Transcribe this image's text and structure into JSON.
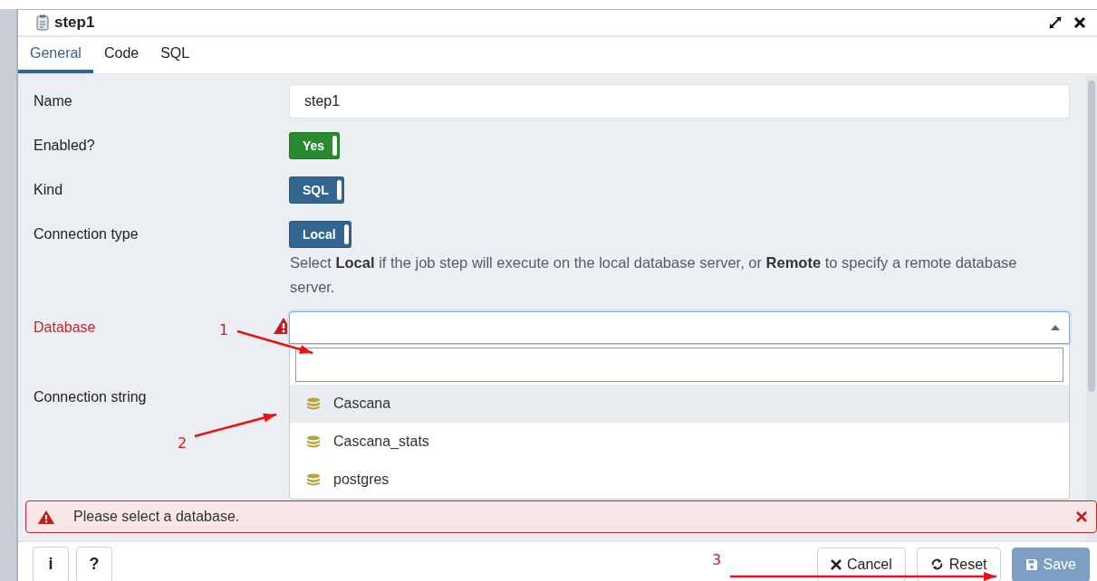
{
  "window": {
    "title": "step1"
  },
  "tabs": [
    {
      "label": "General",
      "selected": true
    },
    {
      "label": "Code",
      "selected": false
    },
    {
      "label": "SQL",
      "selected": false
    }
  ],
  "fields": [
    {
      "kind": "text",
      "label": "Name",
      "value": "step1",
      "error": false
    },
    {
      "kind": "switch",
      "label": "Enabled?",
      "value": "Yes",
      "on": true,
      "color": "#2a8a2f",
      "error": false
    },
    {
      "kind": "switch",
      "label": "Kind",
      "value": "SQL",
      "on": true,
      "color": "#326690",
      "error": false
    },
    {
      "kind": "switch",
      "label": "Connection type",
      "value": "Local",
      "on": true,
      "color": "#326690",
      "error": false,
      "help": "Select **Local** if the job step will execute on the local database server, or **Remote** to specify a remote database server."
    },
    {
      "kind": "select",
      "label": "Database",
      "error": true,
      "expanded": true,
      "options": [
        {
          "label": "Cascana",
          "selected": true
        },
        {
          "label": "Cascana_stats",
          "selected": false
        },
        {
          "label": "postgres",
          "selected": false
        }
      ]
    },
    {
      "kind": "label",
      "label": "Connection string",
      "error": false
    }
  ],
  "error_message": "Please select a database.",
  "footer": {
    "info": "i",
    "help": "?",
    "buttons": [
      {
        "kind": "cancel",
        "label": "Cancel",
        "disabled": false
      },
      {
        "kind": "reset",
        "label": "Reset",
        "disabled": false
      },
      {
        "kind": "save",
        "label": "Save",
        "disabled": true
      }
    ]
  },
  "annotations": [
    {
      "number": "1"
    },
    {
      "number": "2"
    },
    {
      "number": "3"
    }
  ]
}
